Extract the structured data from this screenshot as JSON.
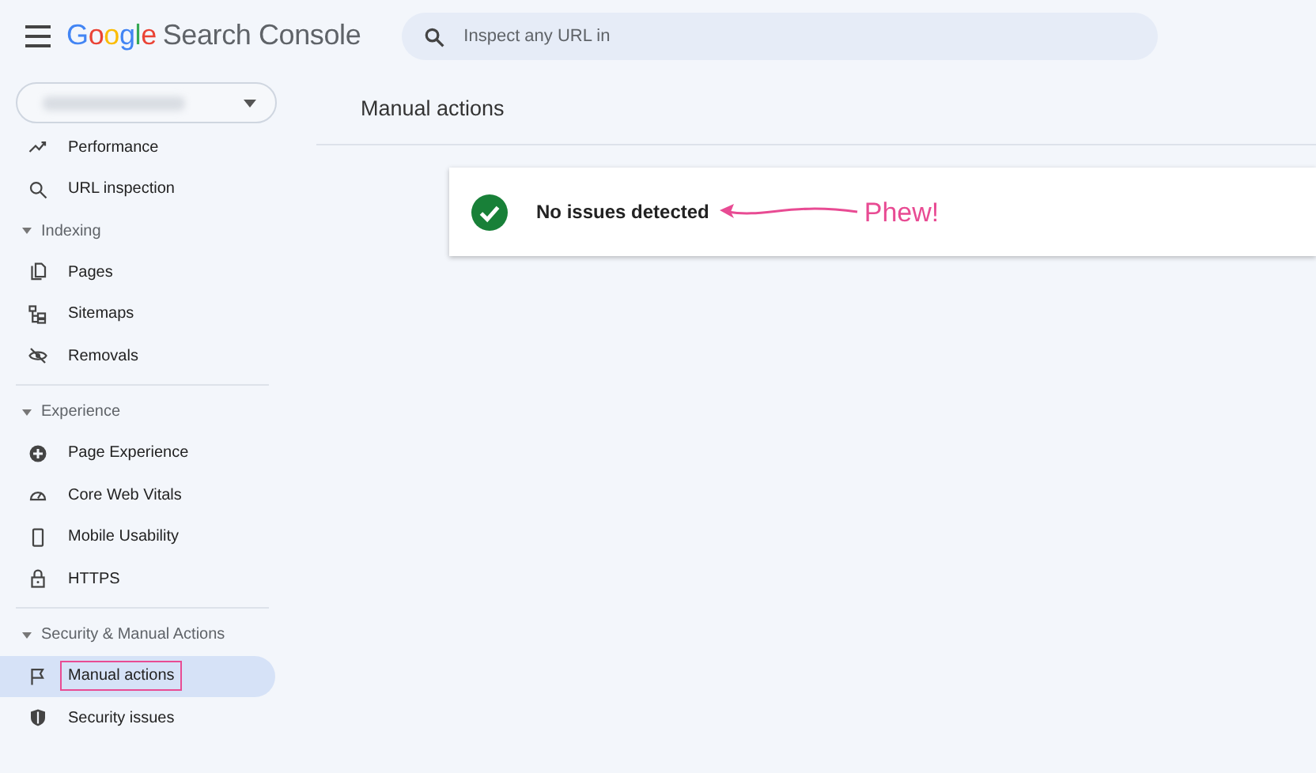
{
  "header": {
    "brand": "Google",
    "product": "Search Console",
    "search": {
      "placeholder": "Inspect any URL in"
    }
  },
  "sidebar": {
    "property_selector": {
      "kind": "dropdown"
    },
    "sections": [
      {
        "items": [
          {
            "label": "Performance",
            "selected": false,
            "annotated": false
          },
          {
            "label": "URL inspection",
            "selected": false,
            "annotated": false
          }
        ]
      },
      {
        "title": "Indexing",
        "expanded": true,
        "items": [
          {
            "label": "Pages",
            "selected": false,
            "annotated": false
          },
          {
            "label": "Sitemaps",
            "selected": false,
            "annotated": false
          },
          {
            "label": "Removals",
            "selected": false,
            "annotated": false
          }
        ]
      },
      {
        "title": "Experience",
        "expanded": true,
        "items": [
          {
            "label": "Page Experience",
            "selected": false,
            "annotated": false
          },
          {
            "label": "Core Web Vitals",
            "selected": false,
            "annotated": false
          },
          {
            "label": "Mobile Usability",
            "selected": false,
            "annotated": false
          },
          {
            "label": "HTTPS",
            "selected": false,
            "annotated": false
          }
        ]
      },
      {
        "title": "Security & Manual Actions",
        "expanded": true,
        "items": [
          {
            "label": "Manual actions",
            "selected": true,
            "annotated": true
          },
          {
            "label": "Security issues",
            "selected": false,
            "annotated": false
          }
        ]
      }
    ]
  },
  "main": {
    "title": "Manual actions",
    "status": {
      "text": "No issues detected",
      "ok": true
    },
    "annotation": {
      "text": "Phew!"
    }
  }
}
